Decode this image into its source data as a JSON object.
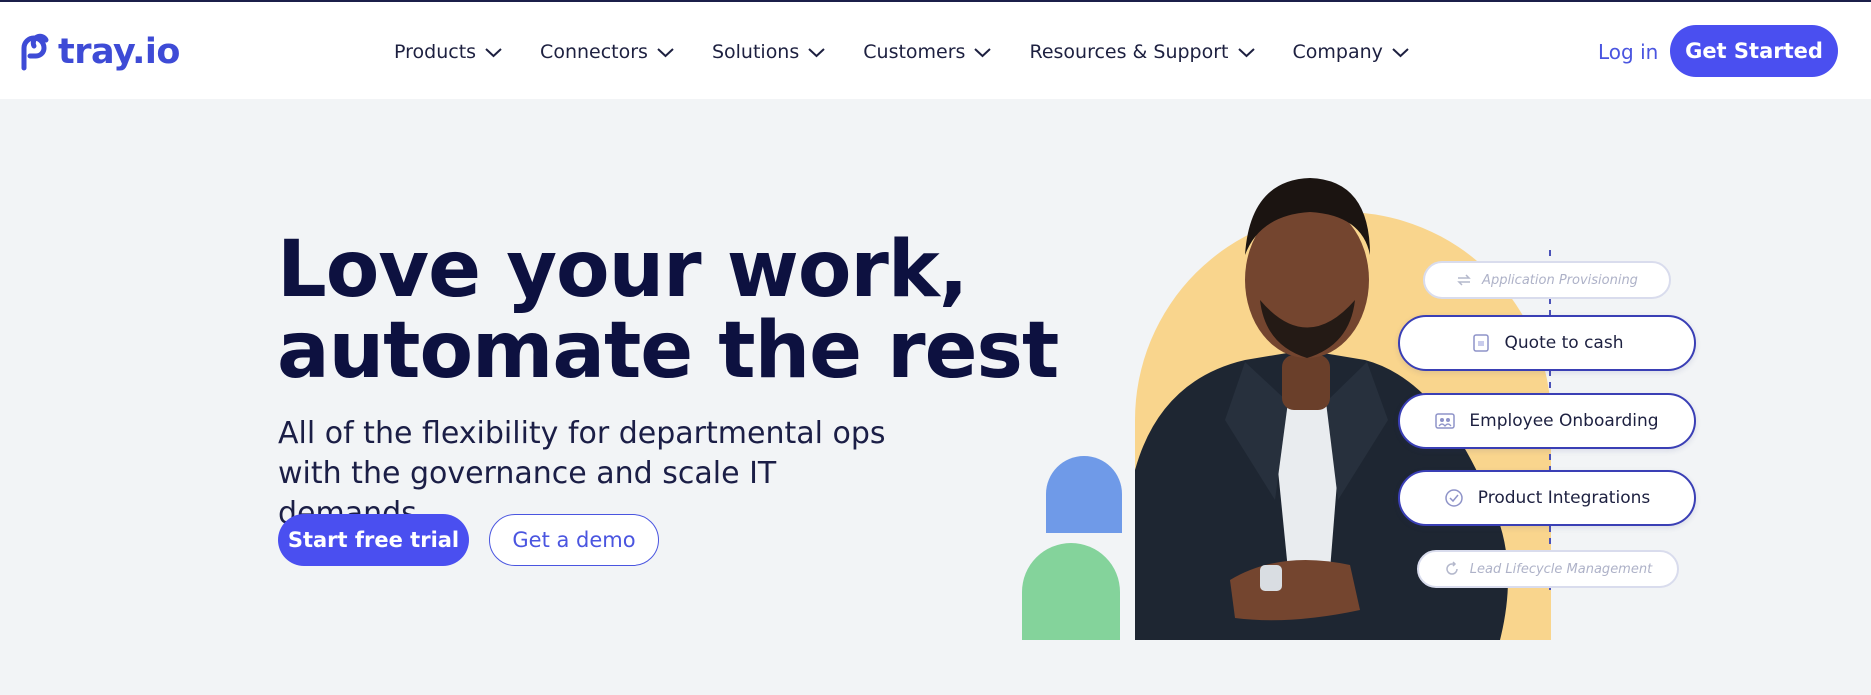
{
  "header": {
    "logo_text": "tray.io",
    "nav": [
      {
        "label": "Products"
      },
      {
        "label": "Connectors"
      },
      {
        "label": "Solutions"
      },
      {
        "label": "Customers"
      },
      {
        "label": "Resources & Support"
      },
      {
        "label": "Company"
      }
    ],
    "login_label": "Log in",
    "cta_label": "Get Started"
  },
  "hero": {
    "title_line1": "Love your work,",
    "title_line2": "automate the rest",
    "subtitle": "All of the flexibility for departmental ops with the governance and scale IT demands",
    "primary_cta": "Start free trial",
    "secondary_cta": "Get a demo"
  },
  "workflow_pills": [
    {
      "label": "Application Provisioning",
      "icon": "sync-icon"
    },
    {
      "label": "Quote to cash",
      "icon": "invoice-icon"
    },
    {
      "label": "Employee Onboarding",
      "icon": "team-icon"
    },
    {
      "label": "Product Integrations",
      "icon": "check-circle-icon"
    },
    {
      "label": "Lead Lifecycle Management",
      "icon": "refresh-icon"
    }
  ],
  "colors": {
    "brand": "#4a4ff0",
    "navy": "#0d1140",
    "background": "#f2f4f6",
    "blob_yellow": "#f9d58d",
    "blob_blue": "#6f9ae8",
    "blob_green": "#84d39b"
  }
}
